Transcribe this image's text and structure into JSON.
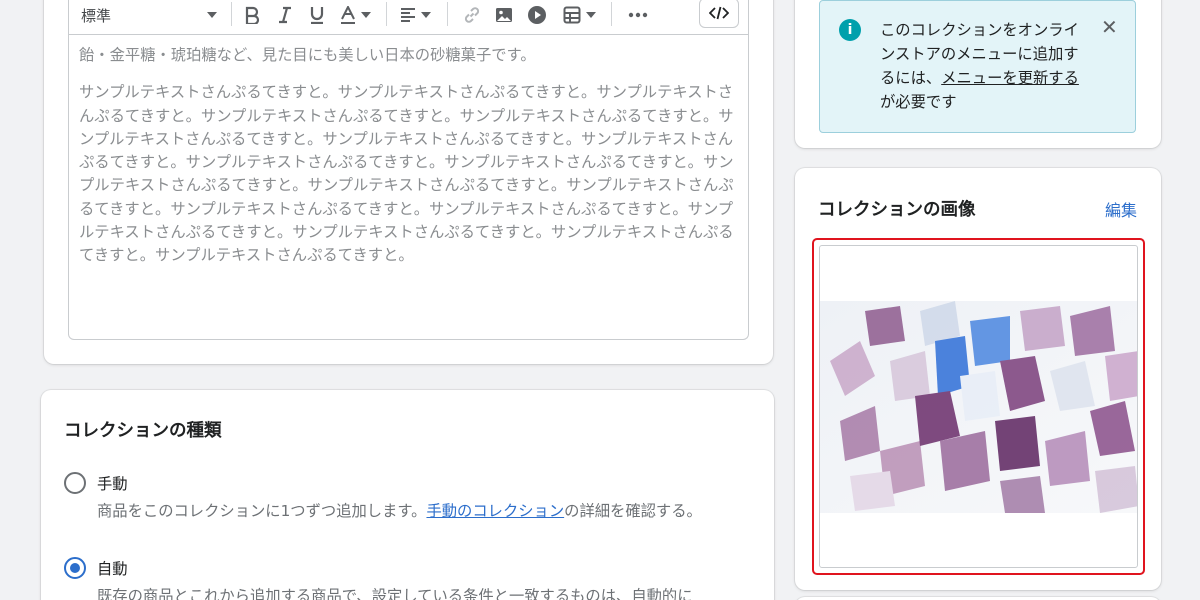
{
  "toolbar": {
    "format_label": "標準",
    "icons": [
      "bold-icon",
      "italic-icon",
      "underline-icon",
      "text-color-icon",
      "align-icon",
      "link-icon",
      "image-icon",
      "video-icon",
      "table-icon",
      "more-icon",
      "code-icon"
    ]
  },
  "editor": {
    "paragraph1": "飴・金平糖・琥珀糖など、見た目にも美しい日本の砂糖菓子です。",
    "paragraph2": "サンプルテキストさんぷるてきすと。サンプルテキストさんぷるてきすと。サンプルテキストさんぷるてきすと。サンプルテキストさんぷるてきすと。サンプルテキストさんぷるてきすと。サンプルテキストさんぷるてきすと。サンプルテキストさんぷるてきすと。サンプルテキストさんぷるてきすと。サンプルテキストさんぷるてきすと。サンプルテキストさんぷるてきすと。サンプルテキストさんぷるてきすと。サンプルテキストさんぷるてきすと。サンプルテキストさんぷるてきすと。サンプルテキストさんぷるてきすと。サンプルテキストさんぷるてきすと。サンプルテキストさんぷるてきすと。サンプルテキストさんぷるてきすと。サンプルテキストさんぷるてきすと。サンプルテキストさんぷるてきすと。"
  },
  "collection_type": {
    "title": "コレクションの種類",
    "manual": {
      "label": "手動",
      "help_before": "商品をこのコレクションに1つずつ追加します。",
      "help_link": "手動のコレクション",
      "help_after": "の詳細を確認する。",
      "selected": false
    },
    "automatic": {
      "label": "自動",
      "help": "既存の商品とこれから追加する商品で、設定している条件と一致するものは、自動的に",
      "selected": true
    }
  },
  "notice": {
    "text_before": "このコレクションをオンラインストアのメニューに追加するには、",
    "link": "メニューを更新する",
    "text_after": "が必要です",
    "close_glyph": "✕",
    "info_glyph": "i"
  },
  "image_card": {
    "title": "コレクションの画像",
    "edit_label": "編集",
    "image_subject": "colorful-kohakuto-candy-photo"
  },
  "colors": {
    "accent": "#2c6ecb",
    "info_bg": "#e3f4f8",
    "info_border": "#9ccfdc",
    "info_icon": "#00a0ac",
    "highlight": "#e0141e"
  }
}
